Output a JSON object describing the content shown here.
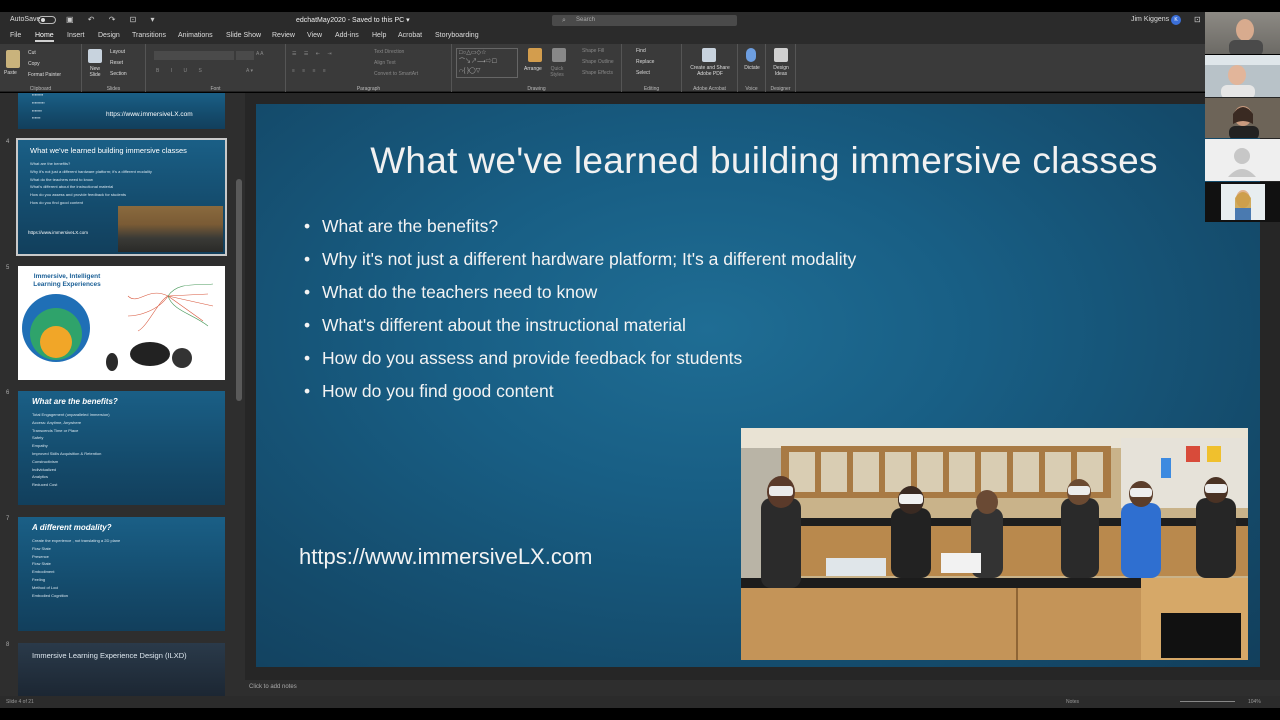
{
  "titlebar": {
    "autosave": "AutoSave",
    "document": "edchatMay2020  -  Saved to this PC ▾",
    "search_placeholder": "Search",
    "user_name": "Jim Kiggens",
    "user_initial": "K"
  },
  "menu": {
    "tabs": [
      "File",
      "Home",
      "Insert",
      "Design",
      "Transitions",
      "Animations",
      "Slide Show",
      "Review",
      "View",
      "Add-ins",
      "Help",
      "Acrobat",
      "Storyboarding"
    ],
    "active": "Home"
  },
  "ribbon": {
    "clipboard": {
      "paste": "Paste",
      "cut": "Cut",
      "copy": "Copy",
      "format_painter": "Format Painter",
      "label": "Clipboard"
    },
    "slides": {
      "new_slide": "New Slide",
      "layout": "Layout",
      "reset": "Reset",
      "section": "Section",
      "label": "Slides"
    },
    "font": {
      "label": "Font"
    },
    "paragraph": {
      "text_direction": "Text Direction",
      "align_text": "Align Text",
      "convert_smartart": "Convert to SmartArt",
      "label": "Paragraph"
    },
    "drawing": {
      "arrange": "Arrange",
      "quick_styles": "Quick Styles",
      "shape_fill": "Shape Fill",
      "shape_outline": "Shape Outline",
      "shape_effects": "Shape Effects",
      "label": "Drawing"
    },
    "editing": {
      "find": "Find",
      "replace": "Replace",
      "select": "Select",
      "label": "Editing"
    },
    "adobe": {
      "share": "Create and Share Adobe PDF",
      "label": "Adobe Acrobat"
    },
    "voice": {
      "dictate": "Dictate",
      "label": "Voice"
    },
    "designer": {
      "design_ideas": "Design Ideas",
      "label": "Designer"
    }
  },
  "thumbnails": {
    "t3": {
      "url": "https://www.immersiveLX.com"
    },
    "t4": {
      "number": "4",
      "title": "What we've learned building immersive classes",
      "lines": [
        "What are the benefits?",
        "Why it's not just a different hardware platform; it's a different modality",
        "What do the teachers need to know",
        "What's different about the instructional material",
        "How do you assess and provide feedback for students",
        "How do you find good content"
      ],
      "url": "https://www.immersiveLX.com"
    },
    "t5": {
      "number": "5",
      "title": "Immersive, Intelligent Learning Experiences"
    },
    "t6": {
      "number": "6",
      "title": "What are the benefits?",
      "lines": [
        "Total Engagement (unparalleled Immersion)",
        "Access:  Anytime, Anywhere",
        "Transcends Time or Place",
        "Safety",
        "Empathy",
        "Improved Skills Acquisition & Retention",
        "Constructivism",
        "Individualized",
        "Analytics",
        "Reduced Cost"
      ]
    },
    "t7": {
      "number": "7",
      "title": "A different modality?",
      "lines": [
        "Create the experience , not translating a 2D plane",
        "Flow State",
        "Presence",
        "Flow State",
        "Embodiment",
        "Feeling",
        "Method of Loci",
        "Embodied Cognition"
      ]
    },
    "t8": {
      "number": "8",
      "title": "Immersive Learning Experience Design (ILXD)"
    }
  },
  "slide": {
    "title": "What we've learned building immersive classes",
    "bullets": [
      "What are the benefits?",
      "Why it's not just a different hardware platform; It's a different modality",
      "What do the teachers need to know",
      "What's different about the instructional material",
      "How do you assess and provide feedback for students",
      "How do you find good content"
    ],
    "url": "https://www.immersiveLX.com"
  },
  "notes_placeholder": "Click to add notes",
  "status": {
    "slide_info": "Slide 4 of 21",
    "notes": "Notes",
    "zoom": "104%"
  },
  "colors": {
    "slide_bg": "#1b6088",
    "ribbon_bg": "#3a3a3a",
    "panel_bg": "#2e2e2e",
    "accent_user": "#3b6fd8"
  }
}
